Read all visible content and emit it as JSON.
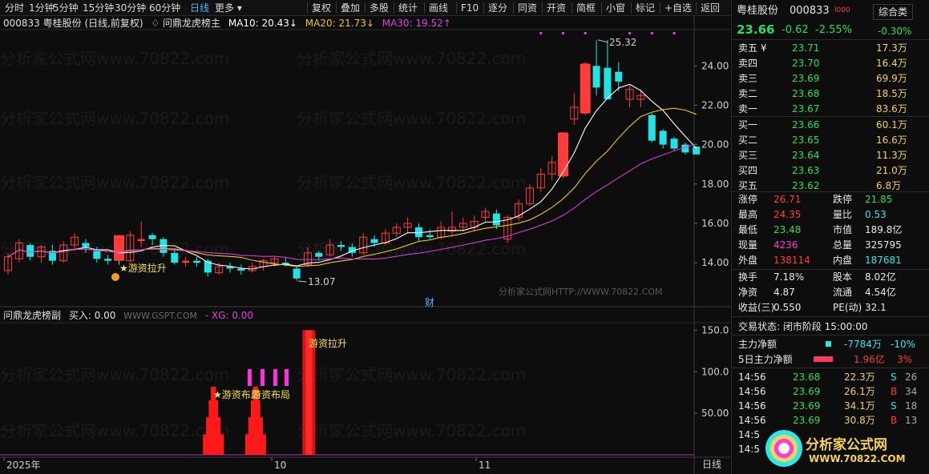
{
  "toolbar": {
    "left": [
      "分时",
      "1分钟",
      "5分钟",
      "15分钟",
      "30分钟",
      "60分钟",
      "日线",
      "更多 ▾"
    ],
    "active_index": 6,
    "right": [
      "复权",
      "叠加",
      "多股",
      "统计",
      "画线",
      "F10",
      "逐分",
      "同资",
      "开资",
      "简框",
      "小窗",
      "标记",
      "+自选",
      "返回"
    ]
  },
  "main_info": {
    "code_name": "000833 粤桂股份 (日线,前复权)",
    "indicator": "♢ 问鼎龙虎榜主",
    "ma10": "MA10: 20.43↓",
    "ma20": "MA20: 21.73↓",
    "ma30": "MA30: 19.52↑"
  },
  "sub_info": {
    "name": "问鼎龙虎榜副",
    "buy": "买入: 0.00",
    "site": "WWW.GSPT.COM",
    "xg": "- XG: 0.00"
  },
  "annotations": {
    "high": "25.32",
    "low": "13.07",
    "pull1": "★游资拉升",
    "cai": "财",
    "pull2": "游资拉升",
    "layout1": "★游资布局",
    "layout2": "游资布局",
    "site_bottom": "分析家公式网HTTP://WWW.70822.COM"
  },
  "axis": {
    "price_ticks": [
      "24.00",
      "22.00",
      "20.00",
      "18.00",
      "16.00",
      "14.00"
    ],
    "sub_ticks": [
      "150.0",
      "100.0",
      "50.00"
    ],
    "dates": [
      "2025年",
      "10",
      "11"
    ],
    "period": "日线"
  },
  "watermark": "分析家公式网www.70822.com",
  "colors": {
    "up": "#ff3b3b",
    "down": "#22e3e3",
    "ma10": "#ffffff",
    "ma20": "#f0c419",
    "ma30": "#d23bd2"
  },
  "chart_data": {
    "type": "candlestick",
    "price_range": [
      12.5,
      25.8
    ],
    "candles": [
      {
        "o": 13.6,
        "c": 14.3,
        "h": 14.5,
        "l": 13.4
      },
      {
        "o": 14.2,
        "c": 15.0,
        "h": 15.2,
        "l": 14.0
      },
      {
        "o": 14.9,
        "c": 14.3,
        "h": 15.0,
        "l": 14.1
      },
      {
        "o": 14.3,
        "c": 14.8,
        "h": 14.9,
        "l": 14.0
      },
      {
        "o": 14.6,
        "c": 14.1,
        "h": 14.9,
        "l": 13.9
      },
      {
        "o": 14.1,
        "c": 14.9,
        "h": 15.1,
        "l": 14.0
      },
      {
        "o": 14.9,
        "c": 15.3,
        "h": 15.5,
        "l": 14.6
      },
      {
        "o": 15.0,
        "c": 14.8,
        "h": 15.2,
        "l": 14.5
      },
      {
        "o": 14.6,
        "c": 14.2,
        "h": 14.8,
        "l": 14.0
      },
      {
        "o": 14.2,
        "c": 14.1,
        "h": 14.4,
        "l": 13.9
      },
      {
        "o": 14.2,
        "c": 14.1,
        "h": 14.3,
        "l": 13.9
      },
      {
        "o": 14.1,
        "c": 15.4,
        "h": 15.6,
        "l": 14.0
      },
      {
        "o": 15.1,
        "c": 15.2,
        "h": 16.1,
        "l": 14.8
      },
      {
        "o": 15.4,
        "c": 15.2,
        "h": 15.5,
        "l": 14.9
      },
      {
        "o": 15.2,
        "c": 14.5,
        "h": 15.3,
        "l": 14.3
      },
      {
        "o": 14.5,
        "c": 14.0,
        "h": 14.7,
        "l": 13.9
      },
      {
        "o": 14.0,
        "c": 14.1,
        "h": 14.3,
        "l": 13.8
      },
      {
        "o": 14.1,
        "c": 14.0,
        "h": 14.3,
        "l": 13.8
      },
      {
        "o": 14.1,
        "c": 13.5,
        "h": 14.2,
        "l": 13.3
      },
      {
        "o": 13.5,
        "c": 13.8,
        "h": 14.0,
        "l": 13.4
      },
      {
        "o": 13.8,
        "c": 13.7,
        "h": 14.0,
        "l": 13.5
      },
      {
        "o": 13.7,
        "c": 13.6,
        "h": 13.9,
        "l": 13.4
      },
      {
        "o": 13.6,
        "c": 13.8,
        "h": 14.0,
        "l": 13.5
      },
      {
        "o": 13.8,
        "c": 14.1,
        "h": 14.2,
        "l": 13.6
      },
      {
        "o": 14.0,
        "c": 14.2,
        "h": 14.3,
        "l": 13.8
      },
      {
        "o": 14.0,
        "c": 13.9,
        "h": 14.3,
        "l": 13.8
      },
      {
        "o": 13.7,
        "c": 13.2,
        "h": 13.8,
        "l": 13.07
      },
      {
        "o": 13.9,
        "c": 14.5,
        "h": 14.8,
        "l": 13.8
      },
      {
        "o": 14.5,
        "c": 14.3,
        "h": 14.6,
        "l": 14.1
      },
      {
        "o": 14.4,
        "c": 14.9,
        "h": 15.2,
        "l": 14.3
      },
      {
        "o": 14.9,
        "c": 14.8,
        "h": 15.1,
        "l": 14.6
      },
      {
        "o": 14.8,
        "c": 14.5,
        "h": 15.0,
        "l": 14.3
      },
      {
        "o": 14.5,
        "c": 15.3,
        "h": 15.5,
        "l": 14.4
      },
      {
        "o": 15.2,
        "c": 15.0,
        "h": 15.4,
        "l": 14.8
      },
      {
        "o": 15.0,
        "c": 15.5,
        "h": 15.7,
        "l": 14.9
      },
      {
        "o": 15.5,
        "c": 15.8,
        "h": 16.0,
        "l": 15.3
      },
      {
        "o": 15.8,
        "c": 16.0,
        "h": 16.3,
        "l": 15.5
      },
      {
        "o": 15.8,
        "c": 15.3,
        "h": 16.0,
        "l": 15.1
      },
      {
        "o": 15.4,
        "c": 15.3,
        "h": 15.7,
        "l": 15.2
      },
      {
        "o": 15.3,
        "c": 15.8,
        "h": 16.1,
        "l": 15.2
      },
      {
        "o": 15.6,
        "c": 15.8,
        "h": 16.6,
        "l": 15.4
      },
      {
        "o": 15.8,
        "c": 16.0,
        "h": 16.3,
        "l": 15.6
      },
      {
        "o": 15.8,
        "c": 16.1,
        "h": 16.4,
        "l": 15.6
      },
      {
        "o": 16.3,
        "c": 16.6,
        "h": 16.8,
        "l": 16.1
      },
      {
        "o": 16.5,
        "c": 15.9,
        "h": 16.7,
        "l": 15.7
      },
      {
        "o": 15.2,
        "c": 16.3,
        "h": 16.4,
        "l": 15.0
      },
      {
        "o": 16.3,
        "c": 17.0,
        "h": 17.2,
        "l": 16.1
      },
      {
        "o": 17.0,
        "c": 17.8,
        "h": 18.0,
        "l": 16.9
      },
      {
        "o": 17.8,
        "c": 18.5,
        "h": 18.8,
        "l": 17.6
      },
      {
        "o": 18.5,
        "c": 19.1,
        "h": 19.4,
        "l": 18.2
      },
      {
        "o": 18.4,
        "c": 20.6,
        "h": 20.6,
        "l": 18.3
      },
      {
        "o": 21.3,
        "c": 21.9,
        "h": 22.6,
        "l": 21.0
      },
      {
        "o": 21.6,
        "c": 24.1,
        "h": 24.2,
        "l": 21.5
      },
      {
        "o": 24.0,
        "c": 22.9,
        "h": 25.3,
        "l": 22.5
      },
      {
        "o": 23.9,
        "c": 22.3,
        "h": 25.32,
        "l": 22.3
      },
      {
        "o": 23.7,
        "c": 23.2,
        "h": 24.2,
        "l": 22.7
      },
      {
        "o": 22.3,
        "c": 22.8,
        "h": 23.0,
        "l": 21.9
      },
      {
        "o": 22.3,
        "c": 22.5,
        "h": 22.8,
        "l": 21.9
      },
      {
        "o": 21.5,
        "c": 20.2,
        "h": 21.6,
        "l": 20.1
      },
      {
        "o": 20.7,
        "c": 20.0,
        "h": 20.8,
        "l": 19.8
      },
      {
        "o": 20.3,
        "c": 19.8,
        "h": 20.4,
        "l": 19.7
      },
      {
        "o": 20.0,
        "c": 19.6,
        "h": 20.1,
        "l": 19.5
      },
      {
        "o": 19.9,
        "c": 19.5,
        "h": 19.9,
        "l": 19.5
      }
    ],
    "sub_range": [
      0,
      160
    ],
    "signals": [
      {
        "index": 17,
        "value": 80
      },
      {
        "index": 20,
        "value": 80
      },
      {
        "index": 26,
        "value": 150
      }
    ]
  },
  "quote": {
    "title": "粤桂股份",
    "code": "000833",
    "level": "l000",
    "tag": "综合类",
    "price": "23.66",
    "change": "-0.62",
    "pct": "-2.55%",
    "tag_pct": "-0.30%",
    "asks": [
      {
        "label": "卖五 ¥",
        "price": "23.71",
        "vol": "17.3万"
      },
      {
        "label": "卖四",
        "price": "23.70",
        "vol": "16.4万"
      },
      {
        "label": "卖三",
        "price": "23.69",
        "vol": "69.9万"
      },
      {
        "label": "卖二",
        "price": "23.68",
        "vol": "18.5万"
      },
      {
        "label": "卖一",
        "price": "23.67",
        "vol": "83.6万"
      }
    ],
    "bids": [
      {
        "label": "买一",
        "price": "23.66",
        "vol": "60.1万"
      },
      {
        "label": "买二",
        "price": "23.65",
        "vol": "16.6万"
      },
      {
        "label": "买三",
        "price": "23.64",
        "vol": "11.3万"
      },
      {
        "label": "买四",
        "price": "23.63",
        "vol": "21.0万"
      },
      {
        "label": "买五",
        "price": "23.62",
        "vol": "6.8万"
      }
    ],
    "stats": [
      [
        {
          "k": "涨停",
          "v": "26.71",
          "c": "up"
        },
        {
          "k": "跌停",
          "v": "21.85",
          "c": "dn"
        }
      ],
      [
        {
          "k": "最高",
          "v": "24.35",
          "c": "up"
        },
        {
          "k": "量比",
          "v": "0.53",
          "c": "cy"
        }
      ],
      [
        {
          "k": "最低",
          "v": "23.48",
          "c": "dn"
        },
        {
          "k": "市值",
          "v": "189.8亿",
          "c": "wh"
        }
      ],
      [
        {
          "k": "现量",
          "v": "4236",
          "c": "pk"
        },
        {
          "k": "总量",
          "v": "325795",
          "c": "wh"
        }
      ],
      [
        {
          "k": "外盘",
          "v": "138114",
          "c": "up"
        },
        {
          "k": "内盘",
          "v": "187681",
          "c": "cy"
        }
      ]
    ],
    "stats2": [
      [
        {
          "k": "换手",
          "v": "7.18%",
          "c": "wh"
        },
        {
          "k": "股本",
          "v": "8.02亿",
          "c": "wh"
        }
      ],
      [
        {
          "k": "净资",
          "v": "4.87",
          "c": "wh"
        },
        {
          "k": "流通",
          "v": "4.54亿",
          "c": "wh"
        }
      ],
      [
        {
          "k": "收益(三)",
          "v": "0.550",
          "c": "wh"
        },
        {
          "k": "PE(动)",
          "v": "32.1",
          "c": "wh"
        }
      ]
    ],
    "status": "交易状态: 闭市阶段 15:00:00",
    "flow": {
      "label": "主力净额",
      "value": "-7784万",
      "pct": "-10%"
    },
    "flow5": {
      "label": "5日主力净额",
      "value": "1.96亿",
      "pct": "3%"
    },
    "ticks": [
      {
        "t": "14:56",
        "p": "23.68",
        "v": "22.3万",
        "s": "S",
        "n": "26"
      },
      {
        "t": "14:56",
        "p": "23.69",
        "v": "26.1万",
        "s": "B",
        "n": "34"
      },
      {
        "t": "14:56",
        "p": "23.69",
        "v": "34.1万",
        "s": "S",
        "n": "18"
      },
      {
        "t": "14:56",
        "p": "23.69",
        "v": "30.8万",
        "s": "B",
        "n": "13"
      },
      {
        "t": "14:5",
        "p": "",
        "v": "",
        "s": "",
        "n": ""
      },
      {
        "t": "14:5",
        "p": "",
        "v": "",
        "s": "",
        "n": ""
      }
    ],
    "logo_text": "分析家公式网",
    "logo_url": "WWW.70822.COM"
  }
}
